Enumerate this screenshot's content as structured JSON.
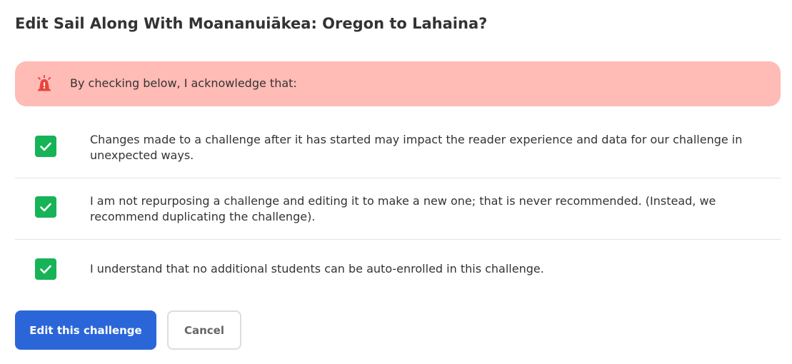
{
  "dialog": {
    "title": "Edit Sail Along With Moananuiākea: Oregon to Lahaina?"
  },
  "alert": {
    "icon": "warning-siren-icon",
    "color": "#ffbbb6",
    "icon_color": "#e8473c",
    "text": "By checking below, I acknowledge that:"
  },
  "acknowledgements": [
    {
      "checked": true,
      "text": "Changes made to a challenge after it has started may impact the reader experience and data for our challenge in unexpected ways."
    },
    {
      "checked": true,
      "text": "I am not repurposing a challenge and editing it to make a new one; that is never recommended. (Instead, we recommend duplicating the challenge)."
    },
    {
      "checked": true,
      "text": "I understand that no additional students can be auto-enrolled in this challenge."
    }
  ],
  "checkbox_color": "#17b357",
  "actions": {
    "primary_label": "Edit this challenge",
    "primary_color": "#2b66d9",
    "secondary_label": "Cancel"
  }
}
